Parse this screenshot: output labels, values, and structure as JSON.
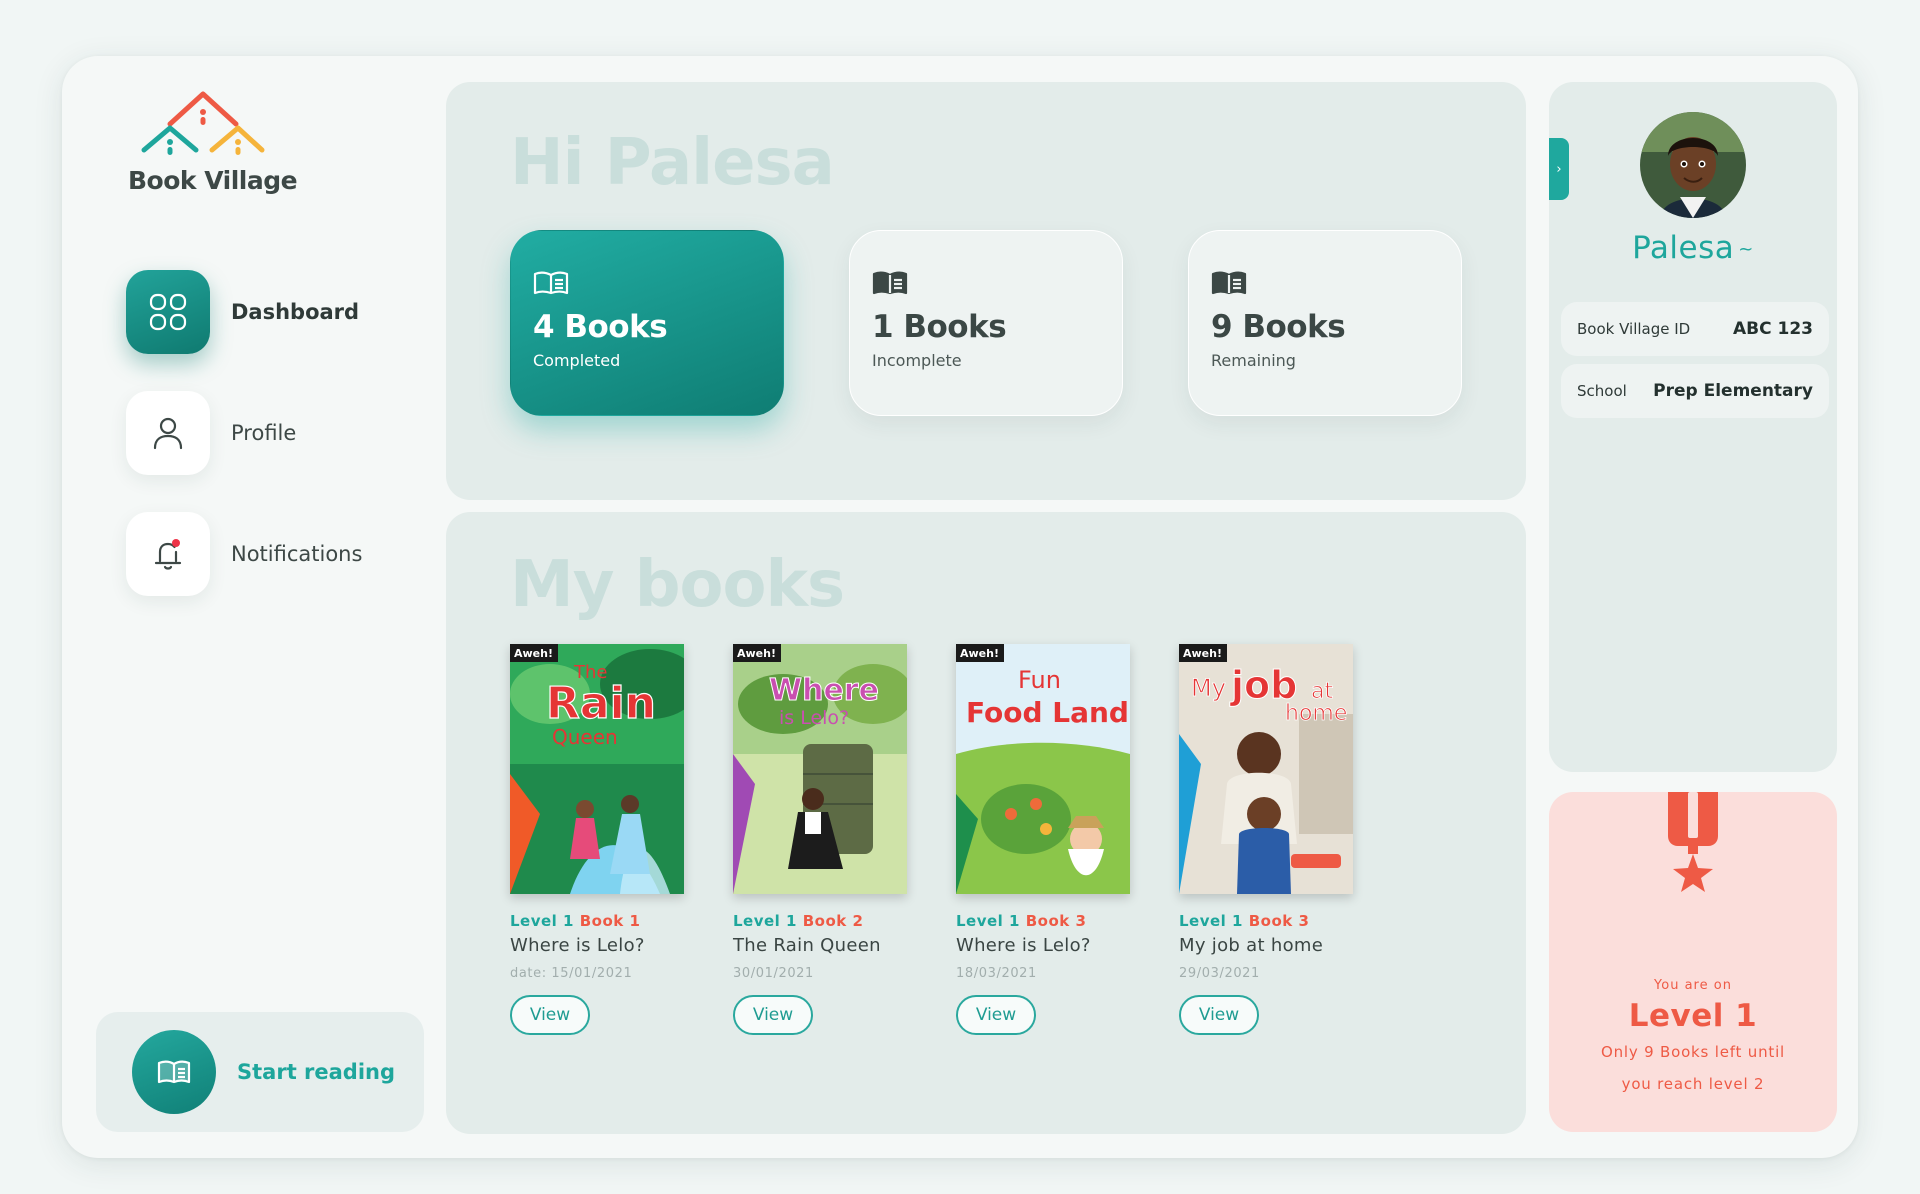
{
  "app": {
    "name": "Book Village"
  },
  "nav": {
    "items": [
      {
        "label": "Dashboard",
        "icon": "dashboard-icon",
        "active": true
      },
      {
        "label": "Profile",
        "icon": "user-icon",
        "active": false
      },
      {
        "label": "Notifications",
        "icon": "bell-icon",
        "active": false
      }
    ],
    "start_reading": "Start reading"
  },
  "greeting": "Hi Palesa",
  "stats": [
    {
      "value": "4 Books",
      "label": "Completed"
    },
    {
      "value": "1 Books",
      "label": "Incomplete"
    },
    {
      "value": "9 Books",
      "label": "Remaining"
    }
  ],
  "my_books": {
    "title": "My books",
    "view_label": "View",
    "books": [
      {
        "level": "Level 1",
        "book": "Book 1",
        "title": "Where is Lelo?",
        "date": "date: 15/01/2021",
        "cover_title": [
          "The",
          "Rain",
          "Queen"
        ],
        "series": "Aweh!"
      },
      {
        "level": "Level 1",
        "book": "Book 2",
        "title": "The Rain Queen",
        "date": "30/01/2021",
        "cover_title": [
          "Where",
          "is Lelo?"
        ],
        "series": "Aweh!"
      },
      {
        "level": "Level 1",
        "book": "Book 3",
        "title": "Where is Lelo?",
        "date": "18/03/2021",
        "cover_title": [
          "Fun",
          "Food Land"
        ],
        "series": "Aweh!"
      },
      {
        "level": "Level 1",
        "book": "Book 3",
        "title": "My job at home",
        "date": "29/03/2021",
        "cover_title": [
          "My",
          "job",
          "at",
          "home"
        ],
        "series": "Aweh!"
      }
    ]
  },
  "profile": {
    "name": "Palesa",
    "caret": "~",
    "toggle": "›",
    "id_label": "Book Village ID",
    "id_value": "ABC 123",
    "school_label": "School",
    "school_value": "Prep Elementary"
  },
  "level_card": {
    "prefix": "You are on",
    "level": "Level 1",
    "message_line1": "Only 9 Books left until",
    "message_line2": "you reach level 2"
  },
  "colors": {
    "teal": "#1ea69c",
    "coral": "#ee5a45",
    "panel": "#e3ecea"
  }
}
